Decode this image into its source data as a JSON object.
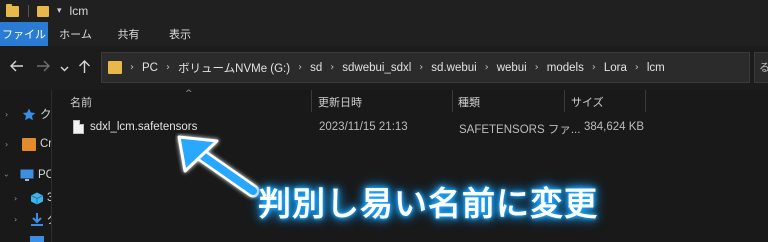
{
  "titlebar": {
    "title": "lcm",
    "quick_access_glyph": "▾"
  },
  "ribbon": {
    "tabs": [
      "ファイル",
      "ホーム",
      "共有",
      "表示"
    ],
    "active_tab": "ファイル",
    "accent": "#2a7bd4"
  },
  "nav": {
    "back_icon": "arrow-left-icon",
    "forward_icon": "arrow-right-icon",
    "recent_icon": "chevron-down-icon",
    "up_icon": "arrow-up-icon",
    "breadcrumbs": [
      "PC",
      "ボリュームNVMe (G:)",
      "sd",
      "sdwebui_sdxl",
      "sd.webui",
      "webui",
      "models",
      "Lora",
      "lcm"
    ],
    "search_edge_text": "る"
  },
  "left_pane": {
    "items": [
      {
        "label": "ク",
        "icon": "star-icon"
      },
      {
        "label": "Cr",
        "icon": "folder-orange-icon"
      },
      {
        "label": "PC",
        "icon": "monitor-icon"
      },
      {
        "label": "3",
        "icon": "cube-icon"
      },
      {
        "label": "ダ",
        "icon": "download-icon"
      }
    ]
  },
  "columns": {
    "name": "名前",
    "modified": "更新日時",
    "type": "種類",
    "size": "サイズ",
    "sort_caret": "^"
  },
  "files": [
    {
      "name": "sdxl_lcm.safetensors",
      "modified": "2023/11/15 21:13",
      "type": "SAFETENSORS ファ...",
      "size": "384,624 KB"
    }
  ],
  "annotation": {
    "text": "判別し易い名前に変更",
    "glow_color": "#1ea7ff",
    "arrow_color": "#29a8ff"
  }
}
